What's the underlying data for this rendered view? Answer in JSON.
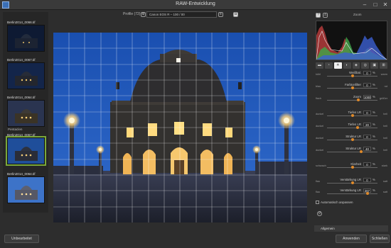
{
  "window": {
    "title": "RAW-Entwicklung",
    "minimize": "–",
    "maximize": "□",
    "close": "✕"
  },
  "toolbar": {
    "profile_label": "Profile (72):",
    "profile_value": "Canon EOS R – 100 / 00"
  },
  "filmstrip": {
    "items": [
      {
        "name": "Berlin2014_0066.tif",
        "caption": ""
      },
      {
        "name": "Berlin2014_0067.tif",
        "caption": ""
      },
      {
        "name": "Berlin2014_0064.tif",
        "caption": "Pentaclen"
      },
      {
        "name": "Berlin2014_0067.tif",
        "caption": ""
      },
      {
        "name": "Berlin2014_0064.tif",
        "caption": ""
      }
    ],
    "selected_index": 3
  },
  "histogram": {
    "label": "Zoom"
  },
  "panel": {
    "params": [
      {
        "lo": "kühl",
        "name": "Weißbal.",
        "value": "0",
        "unit": "%",
        "hi": "warm",
        "pos": 0.5
      },
      {
        "lo": "blau",
        "name": "Farbtonfilter",
        "value": "0",
        "unit": "%",
        "hi": "rot",
        "pos": 0.5
      },
      {
        "lo": "flach",
        "name": "Zoom",
        "value": "1000",
        "unit": "%",
        "hi": "größer",
        "pos": 0.62
      },
      {
        "lo": "dunkel",
        "name": "Tiefen LR",
        "value": "0",
        "unit": "%",
        "hi": "hell",
        "pos": 0.5
      },
      {
        "lo": "dunkel",
        "name": "Tiefen LR",
        "value": "20",
        "unit": "%",
        "hi": "hell",
        "pos": 0.6
      },
      {
        "lo": "dunkel",
        "name": "Struktur LR",
        "value": "0",
        "unit": "%",
        "hi": "hell",
        "pos": 0.5
      },
      {
        "lo": "dunkel",
        "name": "Struktur LR",
        "value": "40",
        "unit": "%",
        "hi": "hell",
        "pos": 0.68
      },
      {
        "lo": "schwach",
        "name": "Klarheit",
        "value": "0",
        "unit": "%",
        "hi": "stark",
        "pos": 0.5
      },
      {
        "lo": "flau",
        "name": "Verstärkung LR",
        "value": "0",
        "unit": "%",
        "hi": "satt",
        "pos": 0.5
      },
      {
        "lo": "flau",
        "name": "Verstärkung LR",
        "value": "267",
        "unit": "%",
        "hi": "satt",
        "pos": 0.8
      }
    ],
    "checkbox_label": "Automatisch anpassen",
    "section_label": "Allgemein"
  },
  "buttons": {
    "cancel": "Unbearbeitet",
    "apply": "Anwenden",
    "close": "Schließen"
  }
}
